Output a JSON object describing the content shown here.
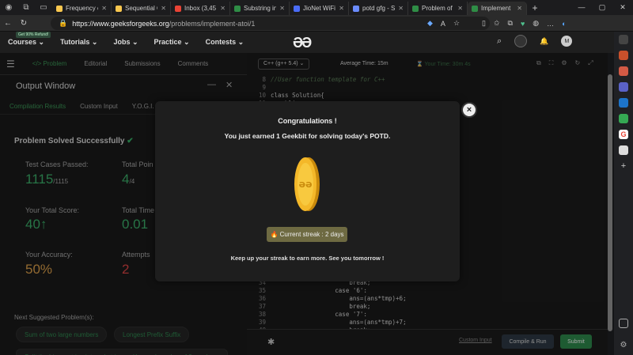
{
  "browser": {
    "tabs": [
      {
        "label": "Frequency c",
        "color": "#f9c74f"
      },
      {
        "label": "Sequential C",
        "color": "#f9c74f"
      },
      {
        "label": "Inbox (3,45",
        "color": "#ea4335"
      },
      {
        "label": "Substring in",
        "color": "#2f8d46"
      },
      {
        "label": "JioNet WiFi",
        "color": "#4a6cf7"
      },
      {
        "label": "potd gfg - S",
        "color": "#6b8cff"
      },
      {
        "label": "Problem of",
        "color": "#2f8d46"
      },
      {
        "label": "Implement",
        "color": "#2f8d46"
      }
    ],
    "url_host": "https://www.geeksforgeeks.org",
    "url_path": "/problems/implement-atoi/1"
  },
  "gfg": {
    "badge": "Get 90% Refund!",
    "menu": [
      "Courses ⌄",
      "Tutorials ⌄",
      "Jobs ⌄",
      "Practice ⌄",
      "Contests ⌄"
    ],
    "avatar": "M"
  },
  "left_tabs": [
    "</> Problem",
    "Editorial",
    "Submissions",
    "Comments"
  ],
  "output": {
    "title": "Output Window",
    "tabs": [
      "Compilation Results",
      "Custom Input",
      "Y.O.G.I. (A"
    ],
    "solved": "Problem Solved Successfully",
    "test_label": "Test Cases Passed:",
    "test_value": "1115",
    "test_total": "/1115",
    "points_label": "Total Poin",
    "points_value": "4",
    "points_total": "/4",
    "score_label": "Your Total Score:",
    "score_value": "40↑",
    "time_label": "Total Time",
    "time_value": "0.01",
    "accuracy_label": "Your Accuracy:",
    "accuracy_value": "50%",
    "attempts_label": "Attempts",
    "attempts_value": "2",
    "next_label": "Next Suggested Problem(s):",
    "suggestions": [
      "Sum of two large numbers",
      "Longest Prefix Suffix",
      "Split the binary string into substrings with equal number of 0s and"
    ]
  },
  "editor": {
    "language": "C++ (g++ 5.4) ⌄",
    "avg_time": "Average Time: 15m",
    "your_time": "⌛ Your Time: 30m 4s",
    "lines_top": [
      {
        "n": "8",
        "code": "//User function template for C++",
        "cls": "cm"
      },
      {
        "n": "9",
        "code": "",
        "cls": ""
      },
      {
        "n": "10",
        "code": "class Solution{",
        "cls": ""
      },
      {
        "n": "11",
        "code": "  public:",
        "cls": ""
      }
    ],
    "lines_bottom": [
      {
        "n": "34",
        "code": "                      break;"
      },
      {
        "n": "35",
        "code": "                  case '6':"
      },
      {
        "n": "36",
        "code": "                      ans=(ans*tmp)+6;"
      },
      {
        "n": "37",
        "code": "                      break;"
      },
      {
        "n": "38",
        "code": "                  case '7':"
      },
      {
        "n": "39",
        "code": "                      ans=(ans*tmp)+7;"
      },
      {
        "n": "40",
        "code": "                      break;"
      }
    ],
    "custom_input": "Custom Input",
    "compile_run": "Compile & Run",
    "submit": "Submit"
  },
  "modal": {
    "title": "Congratulations !",
    "subtitle": "You just earned 1 Geekbit for solving today's POTD.",
    "streak": "🔥 Current streak : 2 days",
    "footer": "Keep up your streak to earn more. See you tomorrow !",
    "close": "×"
  }
}
